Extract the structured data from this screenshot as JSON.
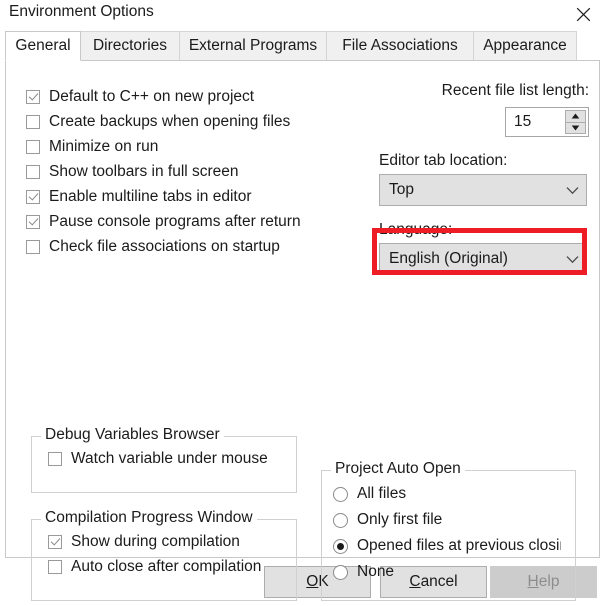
{
  "window": {
    "title": "Environment Options",
    "close_icon": "close-icon"
  },
  "tabs": [
    {
      "label": "General",
      "active": true
    },
    {
      "label": "Directories",
      "active": false
    },
    {
      "label": "External Programs",
      "active": false
    },
    {
      "label": "File Associations",
      "active": false
    },
    {
      "label": "Appearance",
      "active": false
    }
  ],
  "general": {
    "checkboxes": [
      {
        "label": "Default to C++ on new project",
        "checked": true
      },
      {
        "label": "Create backups when opening files",
        "checked": false
      },
      {
        "label": "Minimize on run",
        "checked": false
      },
      {
        "label": "Show toolbars in full screen",
        "checked": false
      },
      {
        "label": "Enable multiline tabs in editor",
        "checked": true
      },
      {
        "label": "Pause console programs after return",
        "checked": true
      },
      {
        "label": "Check file associations on startup",
        "checked": false
      }
    ],
    "recent_file_list": {
      "label": "Recent file list length:",
      "value": "15",
      "up_icon": "spinner-up-icon",
      "down_icon": "spinner-down-icon"
    },
    "editor_tab_location": {
      "label": "Editor tab location:",
      "value": "Top",
      "arrow_icon": "chevron-down-icon"
    },
    "language": {
      "label": "Language:",
      "value": "English (Original)",
      "arrow_icon": "chevron-down-icon",
      "highlight_color": "#ee1c24"
    },
    "debug_variables_browser": {
      "title": "Debug Variables Browser",
      "checkboxes": [
        {
          "label": "Watch variable under mouse",
          "checked": false
        }
      ]
    },
    "compilation_progress_window": {
      "title": "Compilation Progress Window",
      "checkboxes": [
        {
          "label": "Show during compilation",
          "checked": true
        },
        {
          "label": "Auto close after compilation",
          "checked": false
        }
      ]
    },
    "project_auto_open": {
      "title": "Project Auto Open",
      "options": [
        {
          "label": "All files",
          "selected": false
        },
        {
          "label": "Only first file",
          "selected": false
        },
        {
          "label": "Opened files at previous closing",
          "selected": true
        },
        {
          "label": "None",
          "selected": false
        }
      ]
    }
  },
  "footer": {
    "ok": {
      "mnemonic": "O",
      "rest": "K",
      "disabled": false
    },
    "cancel": {
      "mnemonic": "C",
      "rest": "ancel",
      "disabled": false
    },
    "help": {
      "mnemonic": "H",
      "rest": "elp",
      "disabled": true
    }
  }
}
